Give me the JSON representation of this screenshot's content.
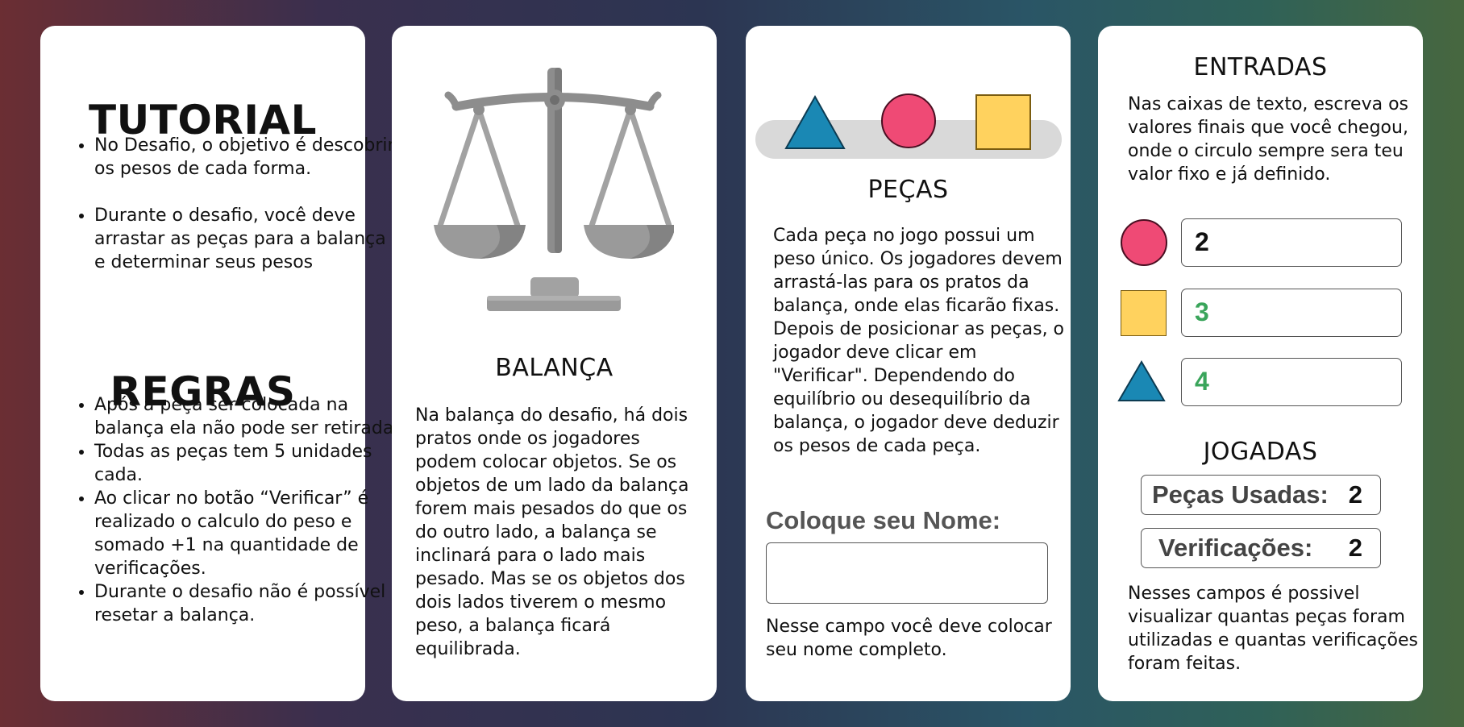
{
  "colors": {
    "circle": "#ef4a75",
    "square": "#ffd25e",
    "triangle": "#1a88b4",
    "value_green": "#3aa55b",
    "scale_gray": "#8d8d8d"
  },
  "tutorial": {
    "title": "TUTORIAL",
    "items": [
      "No Desafio, o objetivo é descobrir os pesos de cada forma.",
      "Durante o desafio, você deve arrastar as peças para a balança e determinar seus pesos"
    ]
  },
  "rules": {
    "title": "REGRAS",
    "items": [
      "Após a peça ser colocada na balança ela não pode ser retirada.",
      "Todas as peças tem 5 unidades cada.",
      "Ao clicar no botão “Verificar” é realizado o calculo do peso e somado +1 na quantidade de verificações.",
      "Durante o desafio não é possível resetar a balança."
    ]
  },
  "balance": {
    "icon": "balance-scale-icon",
    "title": "BALANÇA",
    "text": "Na balança do desafio, há dois pratos onde os jogadores podem colocar objetos. Se os objetos de um lado da balança forem mais pesados do que os do outro lado, a balança se inclinará para o lado mais pesado. Mas se os objetos dos dois lados tiverem o mesmo peso, a balança ficará equilibrada."
  },
  "pieces": {
    "shapes": [
      "triangle-icon",
      "circle-icon",
      "square-icon"
    ],
    "title": "PEÇAS",
    "text": "Cada peça no jogo possui um peso único. Os jogadores devem arrastá-las para os pratos da balança, onde elas ficarão fixas. Depois de posicionar as peças, o jogador deve clicar em \"Verificar\". Dependendo do equilíbrio ou desequilíbrio da balança, o jogador deve deduzir os pesos de cada peça.",
    "name_label": "Coloque seu Nome:",
    "name_value": "",
    "name_help": "Nesse campo você deve colocar seu nome completo."
  },
  "entries": {
    "title": "ENTRADAS",
    "text": "Nas caixas de texto, escreva os valores finais que você chegou, onde o circulo sempre sera teu valor fixo e já definido.",
    "rows": [
      {
        "shape": "circle-icon",
        "value": "2"
      },
      {
        "shape": "square-icon",
        "value": "3"
      },
      {
        "shape": "triangle-icon",
        "value": "4"
      }
    ]
  },
  "plays": {
    "title": "JOGADAS",
    "pieces_used_label": "Peças Usadas:",
    "pieces_used_value": "2",
    "checks_label": "Verificações:",
    "checks_value": "2",
    "text": "Nesses campos é possivel visualizar quantas peças foram utilizadas e quantas verificações foram feitas."
  }
}
